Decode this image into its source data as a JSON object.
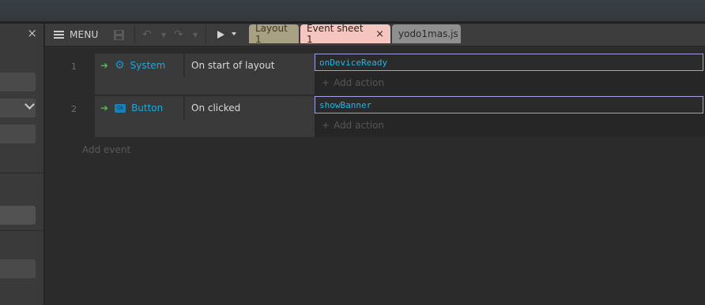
{
  "left_panel": {
    "close_glyph": "×"
  },
  "toolbar": {
    "menu_label": "MENU",
    "icons": [
      "hamburger-icon",
      "save-icon",
      "undo-icon",
      "redo-icon",
      "play-icon"
    ]
  },
  "tabs": [
    {
      "label": "Layout 1",
      "active": false
    },
    {
      "label": "Event sheet 1",
      "active": true,
      "close_glyph": "×"
    },
    {
      "label": "yodo1mas.js",
      "active": false
    }
  ],
  "events": [
    {
      "number": "1",
      "object": "System",
      "object_icon": "gear-icon",
      "condition": "On start of layout",
      "action": "onDeviceReady",
      "add_action_label": "Add action"
    },
    {
      "number": "2",
      "object": "Button",
      "object_icon": "button-object-icon",
      "object_icon_text": "Ok",
      "condition": "On clicked",
      "action": "showBanner",
      "add_action_label": "Add action"
    }
  ],
  "add_event_label": "Add event",
  "colors": {
    "accent_object": "#1ea8d8",
    "arrow": "#3fc23f",
    "active_tab": "#f5c5c0",
    "layout_tab": "#a8a083",
    "action_border": "#9fa1de"
  }
}
